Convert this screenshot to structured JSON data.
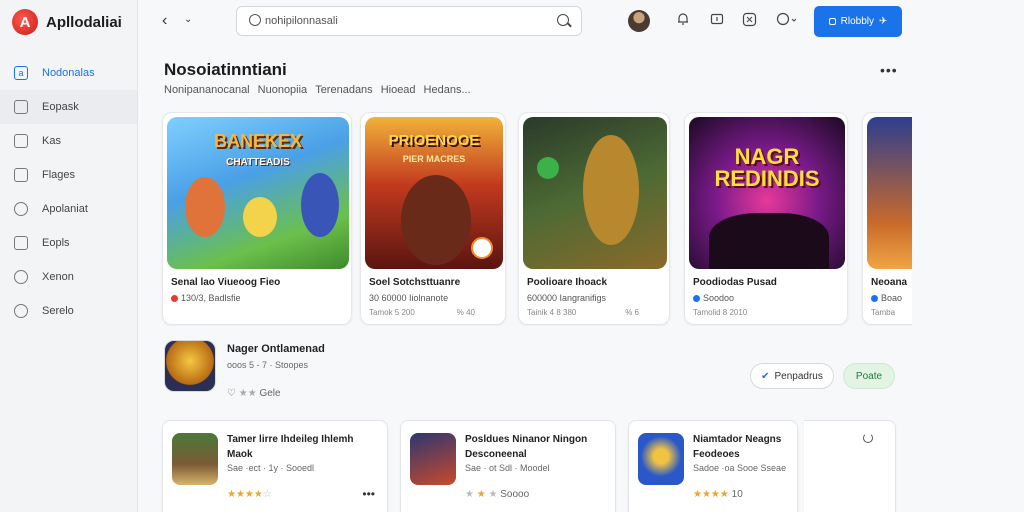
{
  "app": {
    "title": "Apllodaliai",
    "logo_letter": "A"
  },
  "sidebar": {
    "items": [
      {
        "label": "Nodonalas",
        "icon": "home-icon",
        "glyph": "a"
      },
      {
        "label": "Eopask",
        "icon": "folder-icon",
        "glyph": ""
      },
      {
        "label": "Kas",
        "icon": "grid-icon",
        "glyph": ""
      },
      {
        "label": "Flages",
        "icon": "tag-icon",
        "glyph": ""
      },
      {
        "label": "Apolaniat",
        "icon": "chart-icon",
        "glyph": ""
      },
      {
        "label": "Eopls",
        "icon": "list-icon",
        "glyph": ""
      },
      {
        "label": "Xenon",
        "icon": "gauge-icon",
        "glyph": ""
      },
      {
        "label": "Serelo",
        "icon": "settings-icon",
        "glyph": ""
      }
    ]
  },
  "topbar": {
    "back": "‹",
    "forward": "⌄",
    "search_value": "nohipilonnasali",
    "cta_label": "Rlobbly",
    "cta_icon": "✈"
  },
  "section": {
    "title": "Nosoiatinntiani",
    "chips": [
      "Nonipananocanal",
      "Nuonopiia",
      "Terenadans",
      "Hioead",
      "Hedans..."
    ]
  },
  "cards": [
    {
      "art_title": "BANEKEX",
      "art_sub": "CHATTEADIS",
      "name": "Senal lao Viueoog Fieo",
      "meta": "130/3, Badlsfie",
      "meta2": "",
      "meta2r": "",
      "colors": [
        "#f6b73c",
        "#3f7ad6"
      ]
    },
    {
      "art_title": "PRIOENOOE",
      "art_sub": "PIER MACRES",
      "name": "Soel Sotchsttuanre",
      "meta": "30 60000 Iiolnanote",
      "meta2": "Tamok 5 200",
      "meta2r": "% 40",
      "colors": [
        "#b8261b",
        "#f08c2a"
      ]
    },
    {
      "art_title": "",
      "art_sub": "",
      "name": "Poolioare Ihoack",
      "meta": "600000 Iangranifigs",
      "meta2": "Tainik 4 8 380",
      "meta2r": "% 6",
      "colors": [
        "#3a5b2f",
        "#c9952e"
      ]
    },
    {
      "art_title": "NAGR",
      "art_sub": "REDINDIS",
      "name": "Poodiodas Pusad",
      "meta": "Soodoo",
      "meta2": "Tamolid 8 2010",
      "meta2r": "",
      "colors": [
        "#5b0b6d",
        "#e63c8f"
      ]
    },
    {
      "art_title": "",
      "art_sub": "",
      "name": "Neoana",
      "meta": "Boao",
      "meta2": "Tamba",
      "meta2r": "",
      "colors": [
        "#2c3e8f",
        "#f0a544"
      ]
    }
  ],
  "featured": {
    "title": "Nager Ontlamenad",
    "meta": "ooos 5 - 7 · Stoopes",
    "rating": "Gele",
    "btn_outline": "Penpadrus",
    "btn_green": "Poate"
  },
  "bottom": [
    {
      "title": "Tamer lirre Ihdeileg Ihlemh Maok",
      "meta": "Sae ·ect · 1y · Sooedl",
      "stars": 4,
      "colors": [
        "#7a5a35",
        "#d9b36a"
      ]
    },
    {
      "title": "Posldues Ninanor Ningon Desconeenal",
      "meta": "Sae · ot Sdl · Moodel",
      "stars": 2,
      "colors": [
        "#2d3670",
        "#c84a2b"
      ]
    },
    {
      "title": "Niamtador Neagns Feodeoes",
      "meta": "Sadoe ·oa Sooe Sseae",
      "stars": 4,
      "colors": [
        "#2a58c9",
        "#f0c341"
      ]
    }
  ],
  "bottom_ratings": [
    "",
    "Soooo",
    "10"
  ]
}
